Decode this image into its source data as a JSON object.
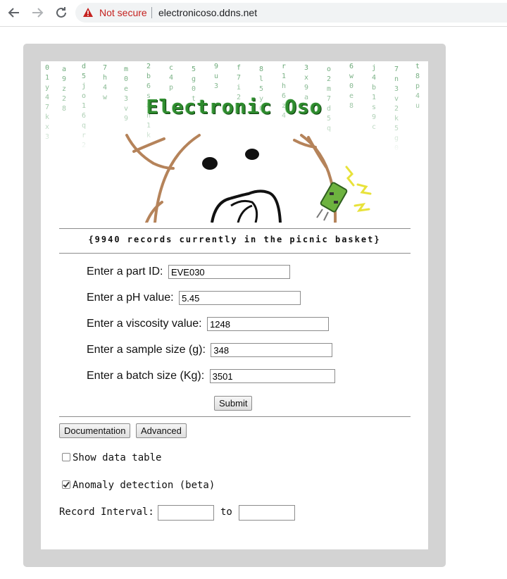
{
  "browser": {
    "security_label": "Not secure",
    "url": "electronicoso.ddns.net"
  },
  "page": {
    "site_title": "Electronic Oso",
    "records_line": "{9940 records currently in the picnic basket}",
    "form": {
      "part_id": {
        "label": "Enter a part ID:",
        "value": "EVE030"
      },
      "ph": {
        "label": "Enter a pH value:",
        "value": "5.45"
      },
      "viscosity": {
        "label": "Enter a viscosity value:",
        "value": "1248"
      },
      "sample_size": {
        "label": "Enter a sample size (g):",
        "value": "348"
      },
      "batch_size": {
        "label": "Enter a batch size (Kg):",
        "value": "3501"
      },
      "submit_label": "Submit"
    },
    "buttons": {
      "documentation": "Documentation",
      "advanced": "Advanced"
    },
    "options": {
      "show_table": {
        "label": "Show data table",
        "checked": false
      },
      "anomaly": {
        "label": "Anomaly detection (beta)",
        "checked": true
      }
    },
    "interval": {
      "label": "Record Interval:",
      "to_label": "to",
      "from_value": "",
      "to_value": ""
    }
  },
  "colors": {
    "frame": "#d3d3d3",
    "title_green": "#2e8b2e",
    "warning_red": "#c5221f",
    "bear_brown": "#b5835a"
  },
  "icons": [
    "back-arrow-icon",
    "forward-arrow-icon",
    "reload-icon",
    "warning-icon",
    "checkmark-icon",
    "bear-illustration",
    "circuit-board-icon"
  ]
}
